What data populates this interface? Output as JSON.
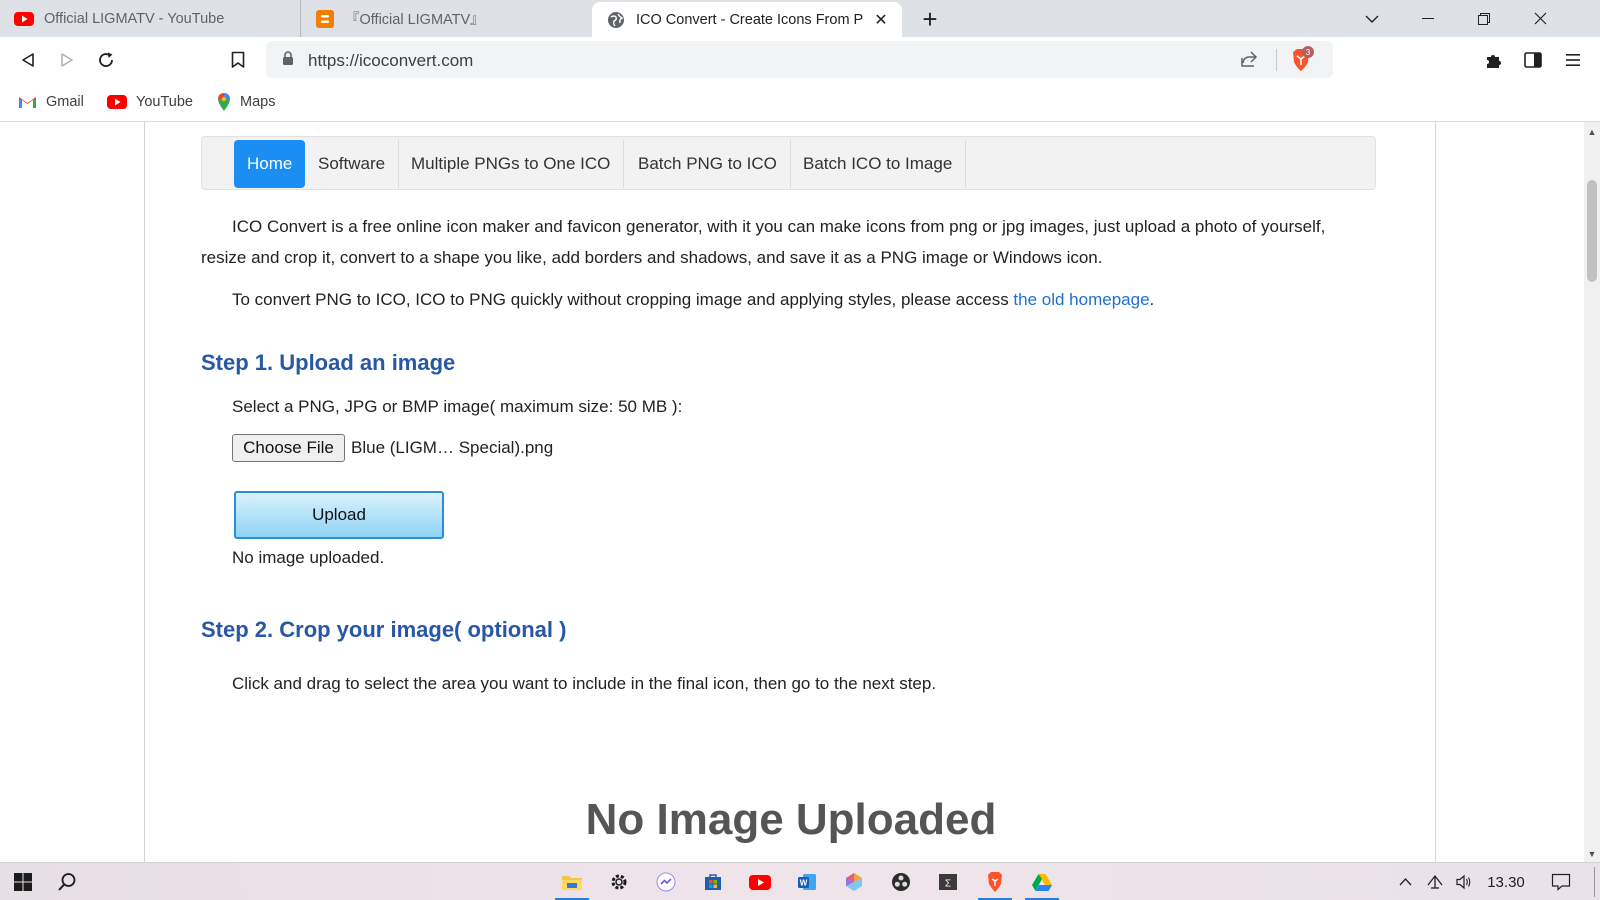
{
  "browser": {
    "tabs": [
      {
        "title": "Official LIGMATV - YouTube",
        "icon": "youtube-icon",
        "active": false
      },
      {
        "title": "『Official LIGMATV』",
        "icon": "blogger-icon",
        "active": false
      },
      {
        "title": "ICO Convert - Create Icons From P",
        "icon": "globe-icon",
        "active": true
      }
    ],
    "url": "https://icoconvert.com",
    "brave_badge": "3",
    "bookmarks": [
      {
        "label": "Gmail",
        "icon": "gmail-icon"
      },
      {
        "label": "YouTube",
        "icon": "youtube-icon"
      },
      {
        "label": "Maps",
        "icon": "maps-icon"
      }
    ]
  },
  "page": {
    "nav": [
      "Home",
      "Software",
      "Multiple PNGs to One ICO",
      "Batch PNG to ICO",
      "Batch ICO to Image"
    ],
    "intro": "ICO Convert is a free online icon maker and favicon generator, with it you can make icons from png or jpg images, just upload a photo of yourself, resize and crop it, convert to a shape you like, add borders and shadows, and save it as a PNG image or Windows icon.",
    "old_text": "To convert PNG to ICO, ICO to PNG quickly without cropping image and applying styles, please access ",
    "old_link": "the old homepage",
    "old_period": ".",
    "step1_title": "Step 1. Upload an image",
    "step1_label": "Select a PNG, JPG or BMP image( maximum size: 50 MB ):",
    "choose_file": "Choose File",
    "file_name": "Blue (LIGM… Special).png",
    "upload": "Upload",
    "no_image": "No image uploaded.",
    "step2_title": "Step 2. Crop your image( optional )",
    "step2_text": "Click and drag to select the area you want to include in the final icon, then go to the next step.",
    "no_image_big": "No Image Uploaded"
  },
  "taskbar": {
    "apps": [
      "file-explorer-icon",
      "settings-icon",
      "messenger-icon",
      "store-icon",
      "youtube-icon",
      "word-icon",
      "photos-icon",
      "obs-icon",
      "terminal-icon",
      "brave-icon",
      "google-drive-icon"
    ],
    "clock": "13.30"
  },
  "colors": {
    "accent": "#1a8ef3",
    "heading": "#2757a6",
    "link": "#1f6fd1"
  }
}
